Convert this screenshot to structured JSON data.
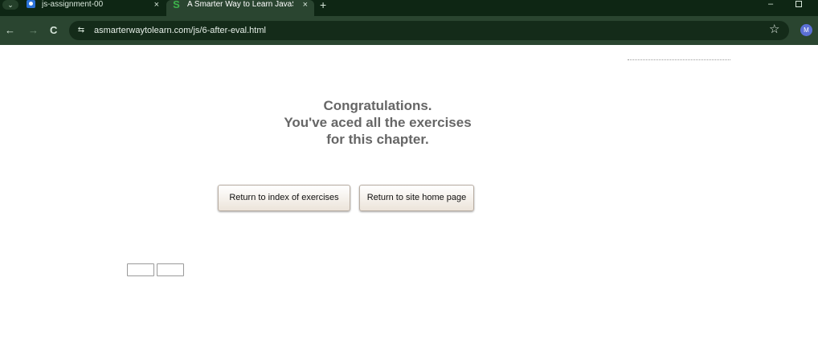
{
  "browser": {
    "tabs": [
      {
        "title": "js-assignment-00",
        "favicon": "doc-user-icon",
        "close": "×",
        "active": false
      },
      {
        "title": "A Smarter Way to Learn JavaSc",
        "favicon": "S",
        "close": "×",
        "active": true
      }
    ],
    "tab_search_glyph": "⌄",
    "new_tab": "+",
    "window": {
      "minimize": "–"
    },
    "nav": {
      "back": "←",
      "forward": "→",
      "reload": "C"
    },
    "site_info_glyph": "⇆",
    "url": "asmarterwaytolearn.com/js/6-after-eval.html",
    "bookmark_glyph": "☆",
    "profile_initial": "M"
  },
  "page": {
    "message_lines": [
      "Congratulations.",
      "You've aced all the exercises",
      "for this chapter."
    ],
    "buttons": {
      "index": "Return to index of exercises",
      "home": "Return to site home page"
    }
  },
  "colors": {
    "chrome_dark": "#0e2614",
    "chrome_toolbar": "#2a4530",
    "message_text": "#666666",
    "avatar": "#5b6fd6"
  }
}
